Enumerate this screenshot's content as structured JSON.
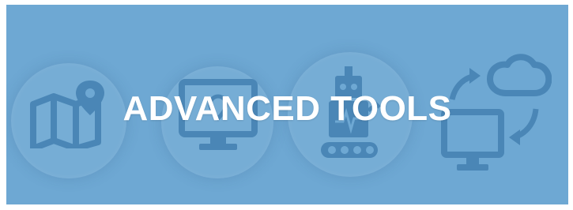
{
  "banner": {
    "title": "ADVANCED TOOLS",
    "background_color": "#6ea8d3",
    "icon_color": "#4a86b6",
    "title_color": "#ffffff"
  },
  "icons": [
    {
      "name": "map-pin-icon"
    },
    {
      "name": "monitor-icon"
    },
    {
      "name": "robot-conveyor-icon"
    },
    {
      "name": "cloud-sync-icon"
    }
  ]
}
